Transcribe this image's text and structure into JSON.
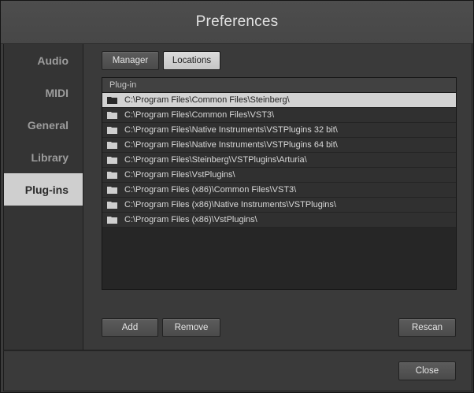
{
  "window": {
    "title": "Preferences"
  },
  "sidebar": {
    "items": [
      {
        "label": "Audio",
        "active": false
      },
      {
        "label": "MIDI",
        "active": false
      },
      {
        "label": "General",
        "active": false
      },
      {
        "label": "Library",
        "active": false
      },
      {
        "label": "Plug-ins",
        "active": true
      }
    ]
  },
  "tabs": {
    "manager_label": "Manager",
    "locations_label": "Locations",
    "active": "Locations"
  },
  "list": {
    "header": "Plug-in",
    "selected_index": 0,
    "icon": "folder-icon",
    "items": [
      "C:\\Program Files\\Common Files\\Steinberg\\",
      "C:\\Program Files\\Common Files\\VST3\\",
      "C:\\Program Files\\Native Instruments\\VSTPlugins 32 bit\\",
      "C:\\Program Files\\Native Instruments\\VSTPlugins 64 bit\\",
      "C:\\Program Files\\Steinberg\\VSTPlugins\\Arturia\\",
      "C:\\Program Files\\VstPlugins\\",
      "C:\\Program Files (x86)\\Common Files\\VST3\\",
      "C:\\Program Files (x86)\\Native Instruments\\VSTPlugins\\",
      "C:\\Program Files (x86)\\VstPlugins\\"
    ]
  },
  "actions": {
    "add_label": "Add",
    "remove_label": "Remove",
    "rescan_label": "Rescan"
  },
  "footer": {
    "close_label": "Close"
  },
  "colors": {
    "window_bg": "#3c3c3c",
    "title_bar": "#4a4a4a",
    "sidebar_bg": "#343434",
    "active_nav": "#cfcfcf",
    "list_bg": "#262626",
    "row_bg": "#303030",
    "selected_row": "#d2d2d2"
  }
}
